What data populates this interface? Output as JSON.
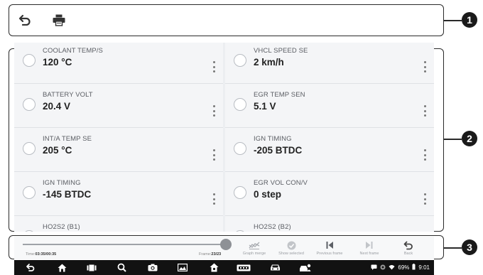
{
  "callouts": [
    "1",
    "2",
    "3"
  ],
  "toolbar": {
    "back_icon": "back-arrow-icon",
    "print_icon": "printer-icon"
  },
  "params": {
    "left": [
      {
        "name": "COOLANT TEMP/S",
        "value": "120 °C"
      },
      {
        "name": "BATTERY VOLT",
        "value": "20.4 V"
      },
      {
        "name": "INT/A TEMP SE",
        "value": "205 °C"
      },
      {
        "name": "IGN TIMING",
        "value": "-145 BTDC"
      },
      {
        "name": "HO2S2 (B1)",
        "value": ""
      }
    ],
    "right": [
      {
        "name": "VHCL SPEED SE",
        "value": "2 km/h"
      },
      {
        "name": "EGR TEMP SEN",
        "value": "5.1 V"
      },
      {
        "name": "IGN TIMING",
        "value": "-205 BTDC"
      },
      {
        "name": "EGR VOL CON/V",
        "value": "0 step"
      },
      {
        "name": "HO2S2 (B2)",
        "value": ""
      }
    ]
  },
  "playback": {
    "time_label": "Time:",
    "time_value": "03:35/00:35",
    "frame_label": "Frame:",
    "frame_value": "23/23",
    "progress": 1.0
  },
  "controls": {
    "graph_merge": "Graph merge",
    "show_selected": "Show selected",
    "previous_frame": "Previous frame",
    "next_frame": "Next frame",
    "back": "Back"
  },
  "statusbar": {
    "battery": "69%",
    "time": "9:01"
  },
  "colors": {
    "frame": "#2a2a2a",
    "navbar": "#121212",
    "panel": "#f4f5f7"
  }
}
